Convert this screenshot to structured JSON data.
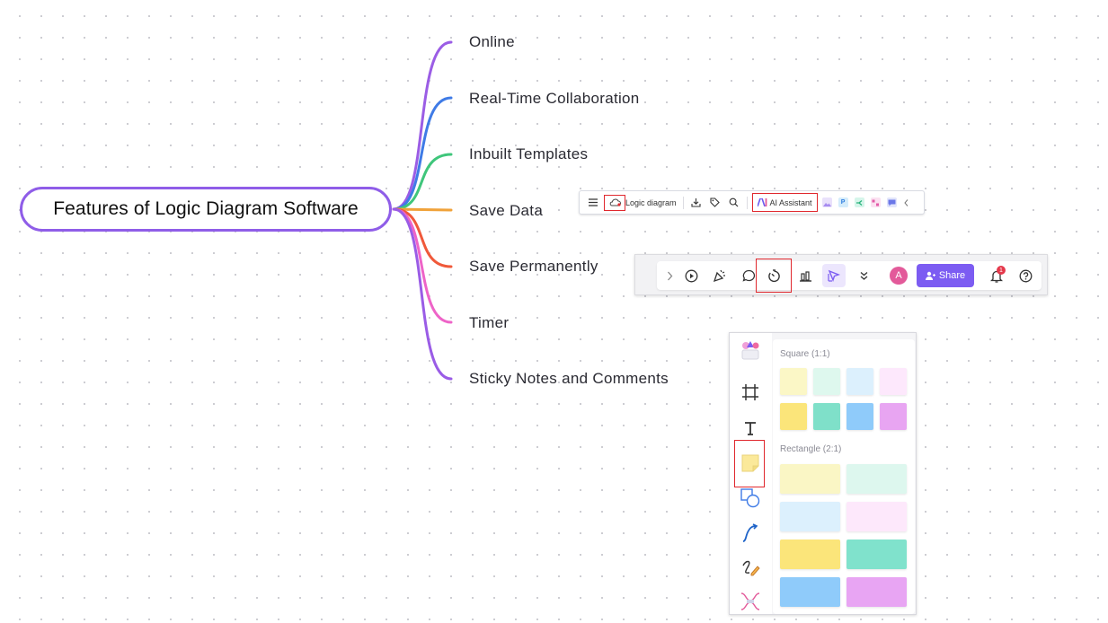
{
  "diagram": {
    "root": {
      "label": "Features of Logic Diagram Software",
      "border_color": "#8f5de8"
    },
    "branches": [
      {
        "label": "Online",
        "color": "#9b5de5"
      },
      {
        "label": "Real-Time Collaboration",
        "color": "#3f7be6"
      },
      {
        "label": "Inbuilt Templates",
        "color": "#3fc67b"
      },
      {
        "label": "Save Data",
        "color": "#f0a23a"
      },
      {
        "label": "Save Permanently",
        "color": "#f0593a"
      },
      {
        "label": "Timer",
        "color": "#ee64c8"
      },
      {
        "label": "Sticky Notes and Comments",
        "color": "#9a5ce6"
      }
    ]
  },
  "toolbar_top": {
    "items": [
      "menu-icon",
      "cloud-save-icon",
      "download-icon",
      "tag-icon",
      "search-icon"
    ],
    "doc_title": "Logic diagram",
    "ai_label": "AI Assistant",
    "mini_labels": [
      "P"
    ],
    "highlight_color": "#e0282e"
  },
  "toolbar_bottom": {
    "icons": [
      "chevron-right-icon",
      "play-icon",
      "celebrate-icon",
      "comment-icon",
      "timer-icon",
      "vote-icon",
      "cursor-icon",
      "more-icon"
    ],
    "avatar_initial": "A",
    "share_label": "Share",
    "notification_count": "1",
    "share_color": "#7c5cf2"
  },
  "sticky_panel": {
    "tools": [
      "templates-icon",
      "frame-icon",
      "text-icon",
      "sticky-note-icon",
      "shape-icon",
      "connector-icon",
      "pen-icon",
      "more-tools-icon"
    ],
    "square_label": "Square (1:1)",
    "rectangle_label": "Rectangle (2:1)",
    "square_colors": [
      "#fbf7c6",
      "#def8ee",
      "#dcf0fd",
      "#fde8fc",
      "#fbe57a",
      "#7fe0c9",
      "#8fcbfa",
      "#e8a5f2"
    ],
    "rectangle_colors": [
      "#faf6c5",
      "#ddf7ee",
      "#dcf0fd",
      "#fde8fb",
      "#fbe57a",
      "#80e2cc",
      "#8fcbfa",
      "#e8a5f3"
    ]
  }
}
